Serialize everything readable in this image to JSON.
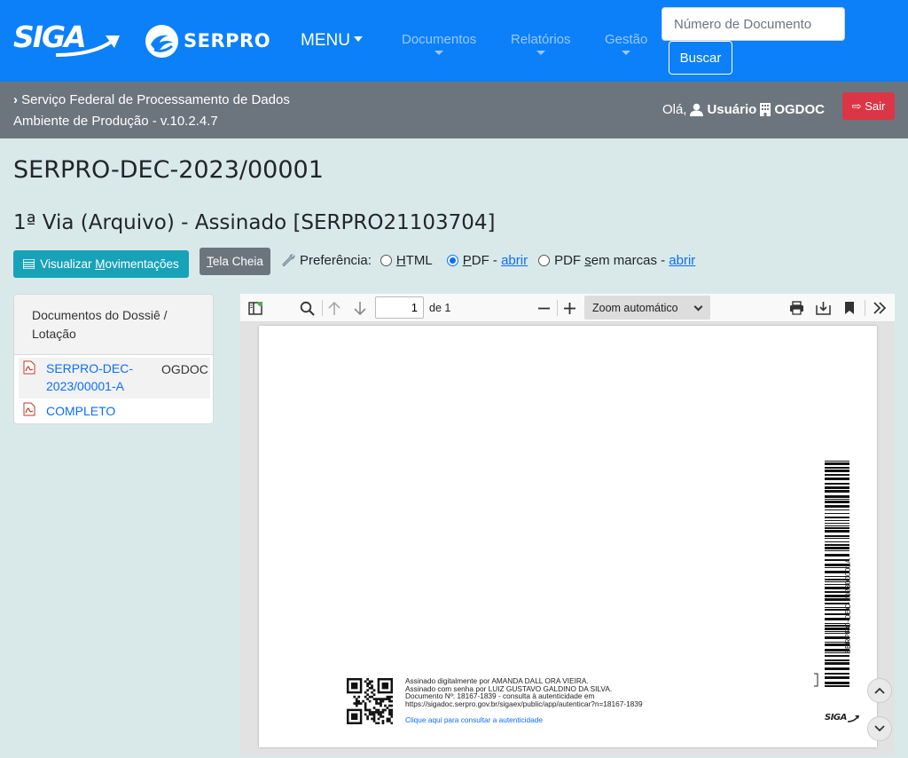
{
  "header": {
    "siga_logo": "SIGA",
    "serpro_logo": "SERPRO",
    "menu_label": "MENU",
    "nav": [
      {
        "label": "Documentos"
      },
      {
        "label": "Relatórios"
      },
      {
        "label": "Gestão"
      }
    ],
    "search_placeholder": "Número de Documento",
    "search_button": "Buscar"
  },
  "infobar": {
    "line1": "Serviço Federal de Processamento de Dados",
    "line2": "Ambiente de Produção - v.10.2.4.7",
    "greeting": "Olá,",
    "user": "Usuário",
    "org": "OGDOC",
    "logout": "Sair"
  },
  "document": {
    "code": "SERPRO-DEC-2023/00001",
    "via_title": "1ª Via (Arquivo) - Assinado [SERPRO21103704]"
  },
  "actions": {
    "movements_prefix": "Visualizar ",
    "movements_key": "M",
    "movements_rest": "ovimentações",
    "fullscreen_key": "T",
    "fullscreen_rest": "ela Cheia",
    "preference_label": "Preferência:",
    "options": {
      "html_key": "H",
      "html_rest": "TML",
      "pdf_key": "P",
      "pdf_rest": "DF",
      "pdf_clean_pre": "PDF ",
      "pdf_clean_key": "s",
      "pdf_clean_rest": "em marcas",
      "open": "abrir",
      "dash": " - "
    },
    "selected": "PDF"
  },
  "dossie": {
    "header": "Documentos do Dossiê / Lotação",
    "items": [
      {
        "link": "SERPRO-DEC-2023/00001-A",
        "link_l1": "SERPRO-DEC-",
        "link_l2": "2023/00001-A",
        "lotacao": "OGDOC"
      },
      {
        "link": "COMPLETO",
        "lotacao": ""
      }
    ]
  },
  "viewer": {
    "page_value": "1",
    "page_of": "de 1",
    "zoom": "Zoom automático",
    "signature_lines": [
      "Assinado digitalmente por AMANDA DALL ORA VIEIRA.",
      "Assinado com senha por LUIZ GUSTAVO GALDINO DA SILVA.",
      "Documento Nº: 18167-1839 - consulta à autenticidade em",
      "https://sigadoc.serpro.gov.br/sigaex/public/app/autenticar?n=18167-1839"
    ],
    "auth_link": "Clique aqui para consultar a autenticidade",
    "barcode_text": "SERPRO-DEC-202300001A",
    "footer_logo": "SIGA"
  },
  "colors": {
    "primary": "#0b80f9",
    "secondary": "#6c757d",
    "danger": "#dc3545",
    "info": "#17a2b8",
    "background": "#d9e9ea"
  }
}
